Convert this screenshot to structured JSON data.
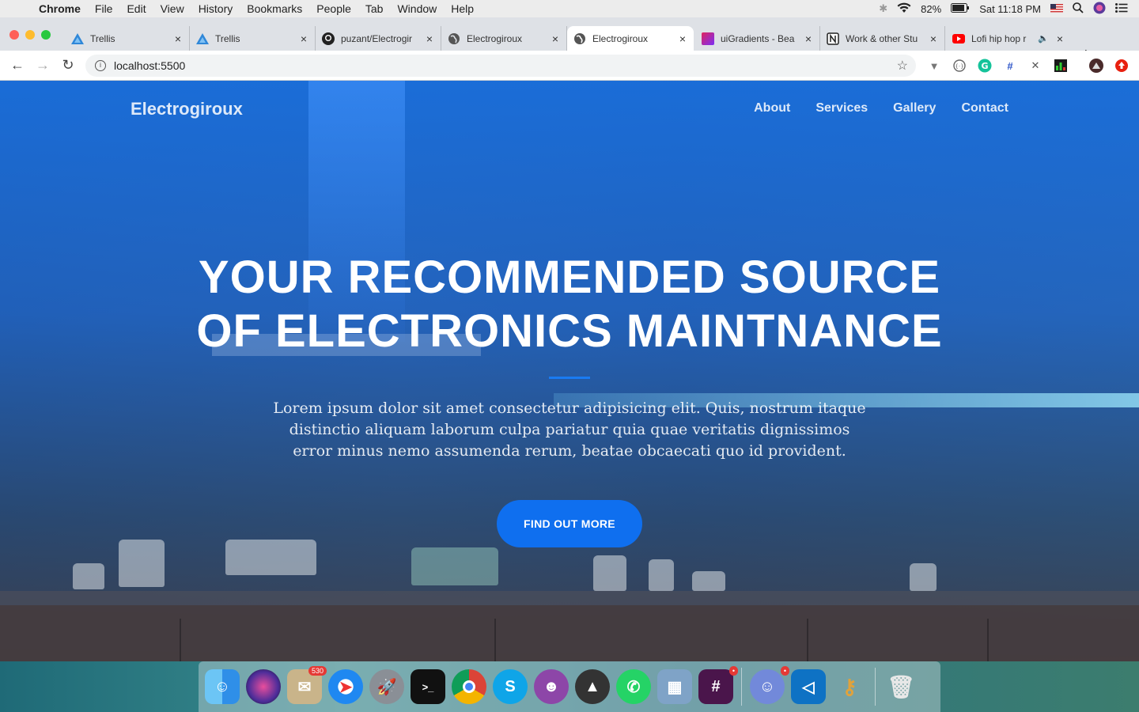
{
  "menubar": {
    "app": "Chrome",
    "items": [
      "File",
      "Edit",
      "View",
      "History",
      "Bookmarks",
      "People",
      "Tab",
      "Window",
      "Help"
    ],
    "battery": "82%",
    "clock": "Sat 11:18 PM"
  },
  "tabs": [
    {
      "title": "Trellis",
      "icon": "trellis-icon"
    },
    {
      "title": "Trellis",
      "icon": "trellis-icon"
    },
    {
      "title": "puzant/Electrogir",
      "icon": "github-icon"
    },
    {
      "title": "Electrogiroux",
      "icon": "globe-icon"
    },
    {
      "title": "Electrogiroux",
      "icon": "globe-icon"
    },
    {
      "title": "uiGradients - Bea",
      "icon": "uigradients-icon"
    },
    {
      "title": "Work & other Stu",
      "icon": "notion-icon"
    },
    {
      "title": "Lofi hip hop r",
      "icon": "youtube-icon"
    }
  ],
  "address": {
    "url": "localhost:5500"
  },
  "site": {
    "brand": "Electrogiroux",
    "nav": [
      "About",
      "Services",
      "Gallery",
      "Contact"
    ],
    "hero_line1": "YOUR RECOMMENDED SOURCE",
    "hero_line2": "OF ELECTRONICS MAINTNANCE",
    "hero_text": "Lorem ipsum dolor sit amet consectetur adipisicing elit. Quis, nostrum itaque distinctio aliquam laborum culpa pariatur quia quae veritatis dignissimos error minus nemo assumenda rerum, beatae obcaecati quo id provident.",
    "cta": "FIND OUT MORE"
  },
  "colors": {
    "accent": "#0f6fef",
    "divider": "#1a7bf2"
  },
  "dock": {
    "mail_badge": "530",
    "apps": [
      "finder-icon",
      "siri-icon",
      "mail-icon",
      "safari-icon",
      "launchpad-icon",
      "terminal-icon",
      "chrome-icon",
      "skype-icon",
      "github-desktop-icon",
      "bear-icon",
      "whatsapp-icon",
      "preview-icon",
      "slack-icon",
      "discord-icon",
      "vscode-icon",
      "keychain-icon",
      "trash-icon"
    ]
  }
}
